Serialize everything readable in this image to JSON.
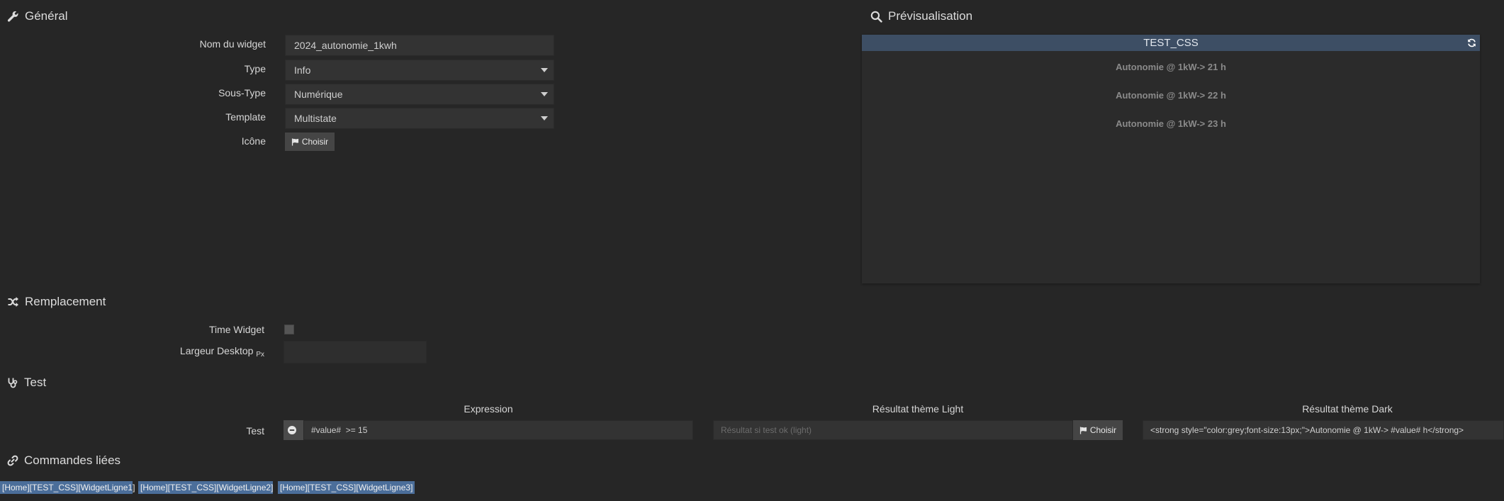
{
  "general": {
    "title": "Général",
    "fields": {
      "name_label": "Nom du widget",
      "name_value": "2024_autonomie_1kwh",
      "type_label": "Type",
      "type_value": "Info",
      "subtype_label": "Sous-Type",
      "subtype_value": "Numérique",
      "template_label": "Template",
      "template_value": "Multistate",
      "icon_label": "Icône",
      "icon_button": "Choisir"
    }
  },
  "preview": {
    "title": "Prévisualisation",
    "widget_name": "TEST_CSS",
    "lines": [
      "Autonomie @ 1kW-> 21 h",
      "Autonomie @ 1kW-> 22 h",
      "Autonomie @ 1kW-> 23 h"
    ]
  },
  "replacement": {
    "title": "Remplacement",
    "time_widget_label": "Time Widget",
    "time_widget_checked": false,
    "width_label": "Largeur Desktop",
    "width_unit": "Px",
    "width_value": ""
  },
  "test": {
    "title": "Test",
    "col_expression": "Expression",
    "col_light": "Résultat thème Light",
    "col_dark": "Résultat thème Dark",
    "row_label": "Test",
    "expression_value": "#value#  >= 15",
    "light_placeholder": "Résultat si test ok (light)",
    "light_button": "Choisir",
    "dark_value": "<strong style=\"color:grey;font-size:13px;\">Autonomie @ 1kW-> #value# h</strong>"
  },
  "linked": {
    "title": "Commandes liées",
    "tags": [
      "[Home][TEST_CSS][WidgetLigne1]",
      "[Home][TEST_CSS][WidgetLigne2]",
      "[Home][TEST_CSS][WidgetLigne3]"
    ]
  },
  "colors": {
    "background": "#262626",
    "input_bg": "#333333",
    "preview_header": "#3d4e64",
    "tag_bg": "#4b6e9a"
  }
}
